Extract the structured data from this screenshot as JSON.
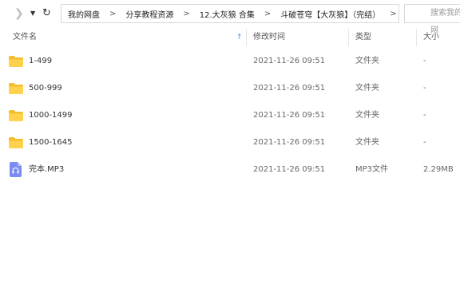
{
  "toolbar": {
    "forward_icon": "chevron-right-icon",
    "dropdown_icon": "caret-down-icon",
    "refresh_icon": "refresh-icon"
  },
  "breadcrumb": [
    {
      "label": "我的网盘"
    },
    {
      "label": "分享教程资源"
    },
    {
      "label": "12.大灰狼 合集"
    },
    {
      "label": "斗破苍穹【大灰狼】（完结）"
    }
  ],
  "search": {
    "placeholder": "搜索我的网"
  },
  "columns": {
    "name": "文件名",
    "modified": "修改时间",
    "type": "类型",
    "size": "大小"
  },
  "files": [
    {
      "name": "1-499",
      "modified": "2021-11-26 09:51",
      "type": "文件夹",
      "size": "-",
      "icon": "folder-icon"
    },
    {
      "name": "500-999",
      "modified": "2021-11-26 09:51",
      "type": "文件夹",
      "size": "-",
      "icon": "folder-icon"
    },
    {
      "name": "1000-1499",
      "modified": "2021-11-26 09:51",
      "type": "文件夹",
      "size": "-",
      "icon": "folder-icon"
    },
    {
      "name": "1500-1645",
      "modified": "2021-11-26 09:51",
      "type": "文件夹",
      "size": "-",
      "icon": "folder-icon"
    },
    {
      "name": "完本.MP3",
      "modified": "2021-11-26 09:51",
      "type": "MP3文件",
      "size": "2.29MB",
      "icon": "audio-file-icon"
    }
  ],
  "colors": {
    "folder": "#FFD24D",
    "folder_back": "#F5BE2E",
    "audio": "#7A8CF0",
    "sort_arrow": "#3B8FE8"
  }
}
